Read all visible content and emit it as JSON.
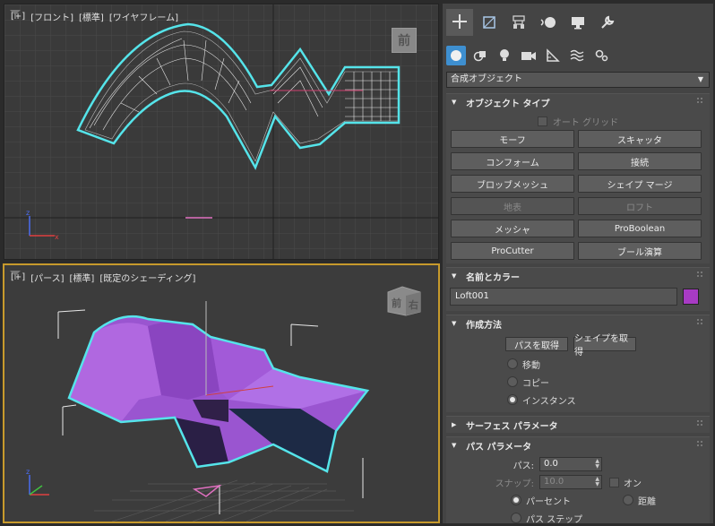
{
  "viewport_top": {
    "label_parts": [
      "[+]",
      "[フロント]",
      "[標準]",
      "[ワイヤフレーム]"
    ],
    "viewcube_face": "前"
  },
  "viewport_bottom": {
    "label_parts": [
      "[+]",
      "[パース]",
      "[標準]",
      "[既定のシェーディング]"
    ],
    "viewcube_face_front": "前",
    "viewcube_face_right": "右"
  },
  "panel": {
    "tabs": [
      "create-icon",
      "modify-icon",
      "hierarchy-icon",
      "motion-icon",
      "display-icon",
      "utilities-icon"
    ],
    "subtabs": [
      "geometry-icon",
      "shapes-icon",
      "lights-icon",
      "cameras-icon",
      "helpers-icon",
      "spacewarps-icon",
      "systems-icon"
    ],
    "category": "合成オブジェクト",
    "object_type": {
      "title": "オブジェクト タイプ",
      "auto_grid": "オート グリッド",
      "buttons": [
        {
          "label": "モーフ",
          "enabled": true
        },
        {
          "label": "スキャッタ",
          "enabled": true
        },
        {
          "label": "コンフォーム",
          "enabled": true
        },
        {
          "label": "接続",
          "enabled": true
        },
        {
          "label": "ブロッブメッシュ",
          "enabled": true
        },
        {
          "label": "シェイプ マージ",
          "enabled": true
        },
        {
          "label": "地表",
          "enabled": false
        },
        {
          "label": "ロフト",
          "enabled": false
        },
        {
          "label": "メッシャ",
          "enabled": true
        },
        {
          "label": "ProBoolean",
          "enabled": true
        },
        {
          "label": "ProCutter",
          "enabled": true
        },
        {
          "label": "ブール演算",
          "enabled": true
        }
      ]
    },
    "name_color": {
      "title": "名前とカラー",
      "name": "Loft001",
      "color": "#a83bc4"
    },
    "creation_method": {
      "title": "作成方法",
      "get_path": "パスを取得",
      "get_shape": "シェイプを取得",
      "options": [
        {
          "label": "移動",
          "selected": false
        },
        {
          "label": "コピー",
          "selected": false
        },
        {
          "label": "インスタンス",
          "selected": true
        }
      ]
    },
    "surface_params": {
      "title": "サーフェス パラメータ"
    },
    "path_params": {
      "title": "パス パラメータ",
      "path_label": "パス:",
      "path_value": "0.0",
      "snap_label": "スナップ:",
      "snap_value": "10.0",
      "snap_on": "オン",
      "percent": "パーセント",
      "distance": "距離",
      "path_steps": "パス ステップ"
    }
  }
}
